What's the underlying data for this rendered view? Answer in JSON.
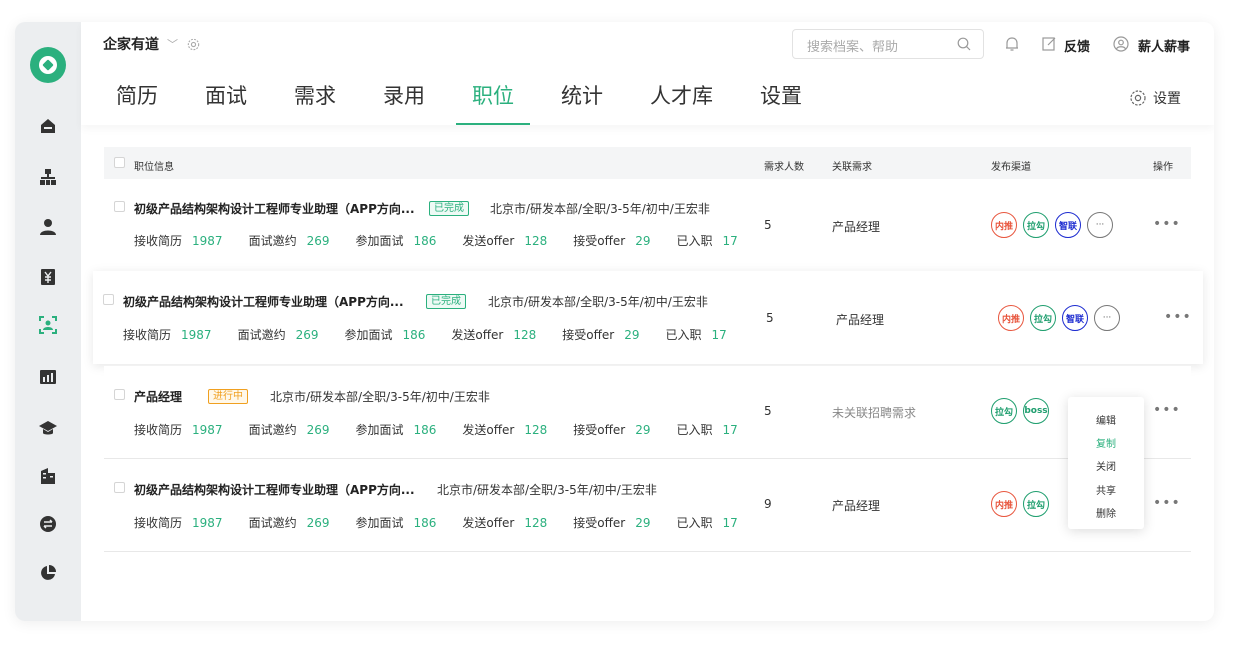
{
  "header": {
    "company": "企家有道",
    "search_placeholder": "搜索档案、帮助",
    "feedback": "反馈",
    "user": "薪人薪事",
    "settings": "设置"
  },
  "tabs": [
    "简历",
    "面试",
    "需求",
    "录用",
    "职位",
    "统计",
    "人才库",
    "设置"
  ],
  "active_tab": "职位",
  "table": {
    "headers": {
      "info": "职位信息",
      "count": "需求人数",
      "req": "关联需求",
      "channels": "发布渠道",
      "ops": "操作"
    },
    "stat_labels": [
      "接收简历",
      "面试邀约",
      "参加面试",
      "发送offer",
      "接受offer",
      "已入职"
    ],
    "rows": [
      {
        "title": "初级产品结构架构设计工程师专业助理（APP方向...",
        "status": "已完成",
        "meta": "北京市/研发本部/全职/3-5年/初中/王宏非",
        "stats": [
          "1987",
          "269",
          "186",
          "128",
          "29",
          "17"
        ],
        "count": "5",
        "req": "产品经理",
        "channels": [
          "内推",
          "拉勾",
          "智联",
          "···"
        ]
      },
      {
        "title": "初级产品结构架构设计工程师专业助理（APP方向...",
        "status": "已完成",
        "meta": "北京市/研发本部/全职/3-5年/初中/王宏非",
        "stats": [
          "1987",
          "269",
          "186",
          "128",
          "29",
          "17"
        ],
        "count": "5",
        "req": "产品经理",
        "channels": [
          "内推",
          "拉勾",
          "智联",
          "···"
        ]
      },
      {
        "title": "产品经理",
        "status": "进行中",
        "meta": "北京市/研发本部/全职/3-5年/初中/王宏非",
        "stats": [
          "1987",
          "269",
          "186",
          "128",
          "29",
          "17"
        ],
        "count": "5",
        "req": "未关联招聘需求",
        "channels": [
          "拉勾",
          "boss"
        ]
      },
      {
        "title": "初级产品结构架构设计工程师专业助理（APP方向...",
        "status": "",
        "meta": "北京市/研发本部/全职/3-5年/初中/王宏非",
        "stats": [
          "1987",
          "269",
          "186",
          "128",
          "29",
          "17"
        ],
        "count": "9",
        "req": "产品经理",
        "channels": [
          "内推",
          "拉勾"
        ]
      }
    ],
    "more_label": "•••"
  },
  "context_menu": [
    "编辑",
    "复制",
    "关闭",
    "共享",
    "删除"
  ],
  "context_menu_active": "复制",
  "colors": {
    "accent": "#2bb07e",
    "danger": "#e8563e",
    "blue": "#1c2bd0",
    "warning": "#f0a020"
  }
}
